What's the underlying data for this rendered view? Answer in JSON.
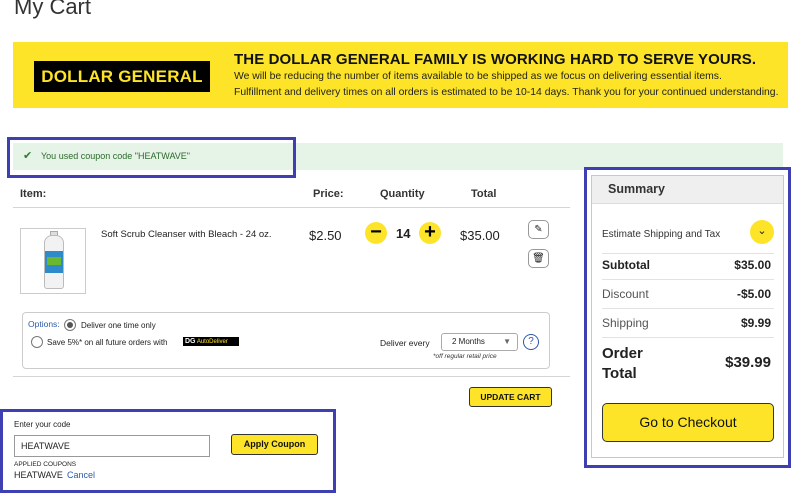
{
  "page": {
    "title": "My Cart"
  },
  "banner": {
    "logo": "DOLLAR GENERAL",
    "headline": "THE DOLLAR GENERAL FAMILY IS WORKING HARD TO SERVE YOURS.",
    "line1": "We will be reducing the number of items available to be shipped as we focus on delivering essential items.",
    "line2": "Fulfillment and delivery times on all orders is estimated to be 10-14 days. Thank you for your continued understanding.",
    "bg_color": "#fde429"
  },
  "coupon_message": {
    "text": "You used coupon code \"HEATWAVE\""
  },
  "cart": {
    "headers": {
      "item": "Item:",
      "price": "Price:",
      "quantity": "Quantity",
      "total": "Total"
    },
    "item": {
      "name": "Soft Scrub Cleanser with Bleach - 24 oz.",
      "price": "$2.50",
      "quantity": "14",
      "total": "$35.00",
      "minus": "−",
      "plus": "+"
    },
    "options": {
      "label": "Options:",
      "one_time": "Deliver one time only",
      "subscribe": "Save 5%* on all future orders with",
      "dg_badge": "DG",
      "dg_badge_suffix": "AutoDeliver",
      "deliver_every_label": "Deliver every",
      "deliver_every_value": "2 Months",
      "disclaimer": "*off regular retail price",
      "help": "?"
    },
    "update_button": "UPDATE CART"
  },
  "coupon_entry": {
    "label": "Enter your code",
    "value": "HEATWAVE",
    "apply_button": "Apply Coupon",
    "applied_label": "APPLIED COUPONS",
    "applied_code": "HEATWAVE",
    "cancel": "Cancel"
  },
  "summary": {
    "title": "Summary",
    "estimate": "Estimate Shipping and Tax",
    "rows": [
      {
        "label": "Subtotal",
        "value": "$35.00"
      },
      {
        "label": "Discount",
        "value": "-$5.00"
      },
      {
        "label": "Shipping",
        "value": "$9.99"
      }
    ],
    "order_total_label": "Order Total",
    "order_total_value": "$39.99",
    "checkout_button": "Go to Checkout"
  },
  "colors": {
    "accent_yellow": "#fde429",
    "highlight_box": "#3d3fb2",
    "link_blue": "#2d59a8"
  }
}
